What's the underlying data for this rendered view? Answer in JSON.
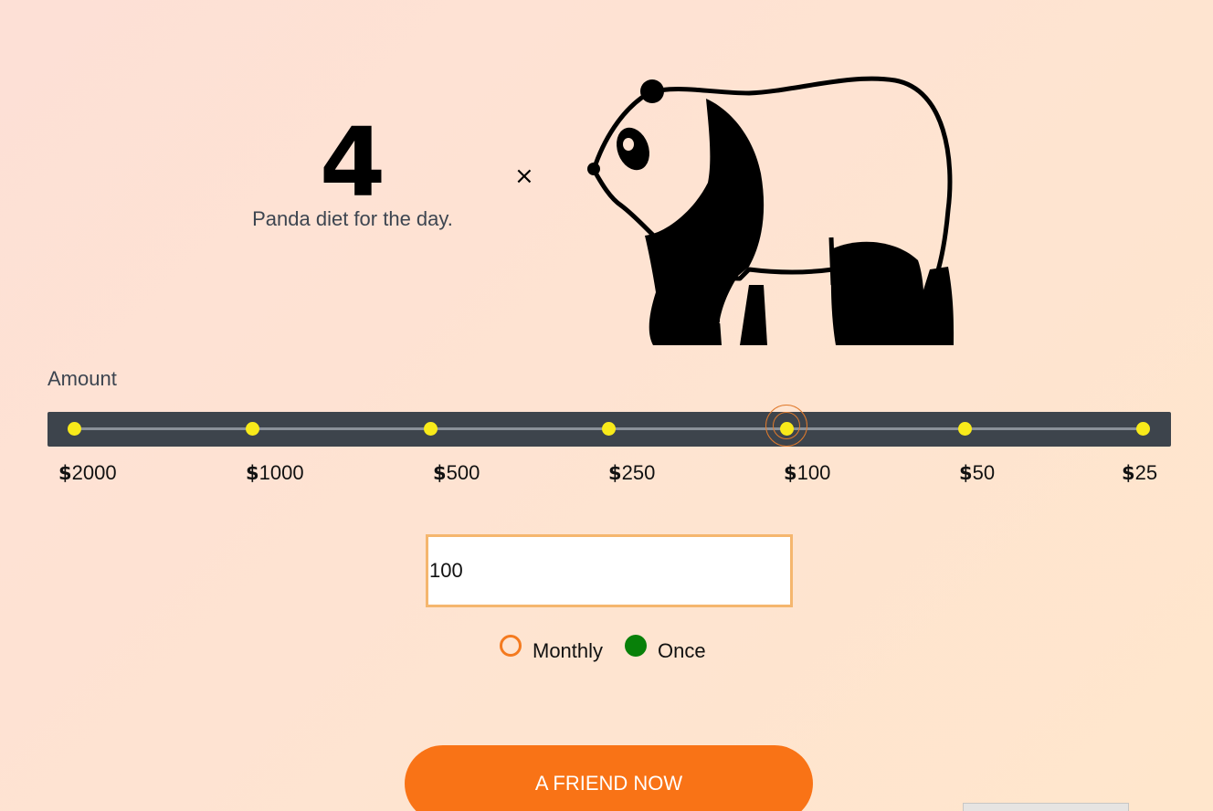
{
  "counter": {
    "value": "4",
    "description": "Panda diet for the day.",
    "multiplier_symbol": "×"
  },
  "illustration": {
    "icon": "panda-icon"
  },
  "amount": {
    "label": "Amount",
    "selected_index": 4,
    "stops": [
      {
        "currency": "$",
        "value": "2000"
      },
      {
        "currency": "$",
        "value": "1000"
      },
      {
        "currency": "$",
        "value": "500"
      },
      {
        "currency": "$",
        "value": "250"
      },
      {
        "currency": "$",
        "value": "100"
      },
      {
        "currency": "$",
        "value": "50"
      },
      {
        "currency": "$",
        "value": "25"
      }
    ],
    "input_value": "100"
  },
  "frequency": {
    "options": [
      {
        "label": "Monthly",
        "selected": false
      },
      {
        "label": "Once",
        "selected": true
      }
    ]
  },
  "cta": {
    "label": "A FRIEND NOW"
  },
  "colors": {
    "accent": "#f97316",
    "slider_bg": "#3d444c",
    "dot": "#f8ea1a",
    "selected_radio": "#088009",
    "input_border": "#f5b66e"
  }
}
